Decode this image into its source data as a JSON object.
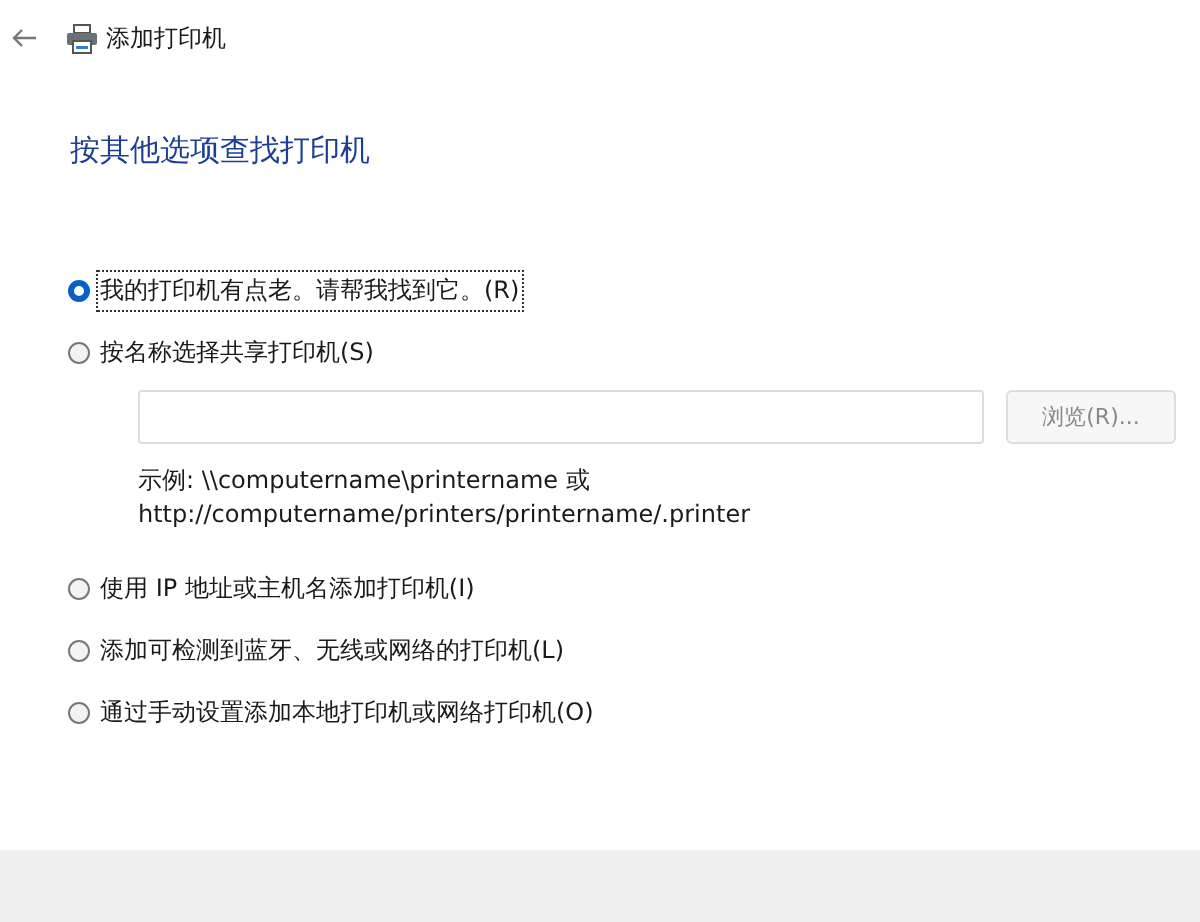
{
  "window": {
    "title": "添加打印机"
  },
  "heading": "按其他选项查找打印机",
  "options": [
    {
      "label": "我的打印机有点老。请帮我找到它。(R)",
      "selected": true
    },
    {
      "label": "按名称选择共享打印机(S)",
      "selected": false,
      "field": {
        "disabled": true
      },
      "browse_button": {
        "label": "浏览(R)...",
        "disabled": true
      },
      "example": [
        "示例: \\\\computername\\printername 或",
        "http://computername/printers/printername/.printer"
      ]
    },
    {
      "label": "使用 IP 地址或主机名添加打印机(I)",
      "selected": false
    },
    {
      "label": "添加可检测到蓝牙、无线或网络的打印机(L)",
      "selected": false
    },
    {
      "label": "通过手动设置添加本地打印机或网络打印机(O)",
      "selected": false
    }
  ]
}
